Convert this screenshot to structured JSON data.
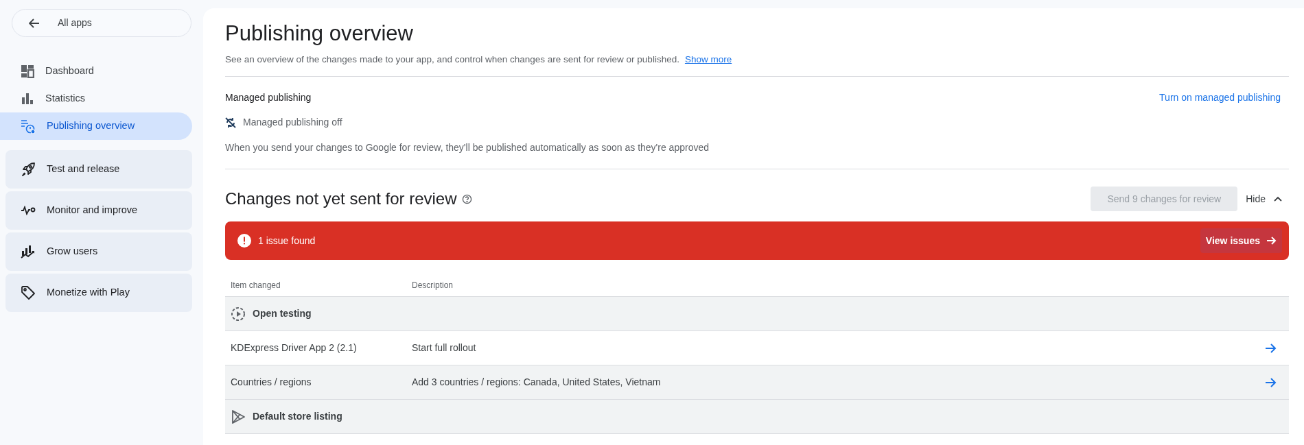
{
  "sidebar": {
    "back": {
      "label": "All apps"
    },
    "items": [
      {
        "label": "Dashboard",
        "selected": false
      },
      {
        "label": "Statistics",
        "selected": false
      },
      {
        "label": "Publishing overview",
        "selected": true
      }
    ],
    "groups": [
      {
        "label": "Test and release"
      },
      {
        "label": "Monitor and improve"
      },
      {
        "label": "Grow users"
      },
      {
        "label": "Monetize with Play"
      }
    ]
  },
  "header": {
    "title": "Publishing overview",
    "subtitle": "See an overview of the changes made to your app, and control when changes are sent for review or published.",
    "link": "Show more"
  },
  "managed": {
    "title": "Managed publishing",
    "action": "Turn on managed publishing",
    "status": "Managed publishing off",
    "description": "When you send your changes to Google for review, they'll be published automatically as soon as they're approved"
  },
  "changes": {
    "title": "Changes not yet sent for review",
    "send_button": {
      "label": "Send 9 changes for review",
      "disabled": true
    },
    "toggle": {
      "label": "Hide",
      "expanded": true
    },
    "banner": {
      "text": "1 issue found",
      "action": "View issues"
    },
    "table": {
      "columns": [
        "Item changed",
        "Description"
      ],
      "rows": [
        {
          "kind": "group",
          "label": "Open testing"
        },
        {
          "kind": "item",
          "item": "KDExpress Driver App 2 (2.1)",
          "description": "Start full rollout",
          "hovered": false
        },
        {
          "kind": "item",
          "item": "Countries / regions",
          "description": "Add 3 countries / regions: Canada, United States, Vietnam",
          "hovered": true
        },
        {
          "kind": "group",
          "label": "Default store listing"
        }
      ]
    }
  }
}
